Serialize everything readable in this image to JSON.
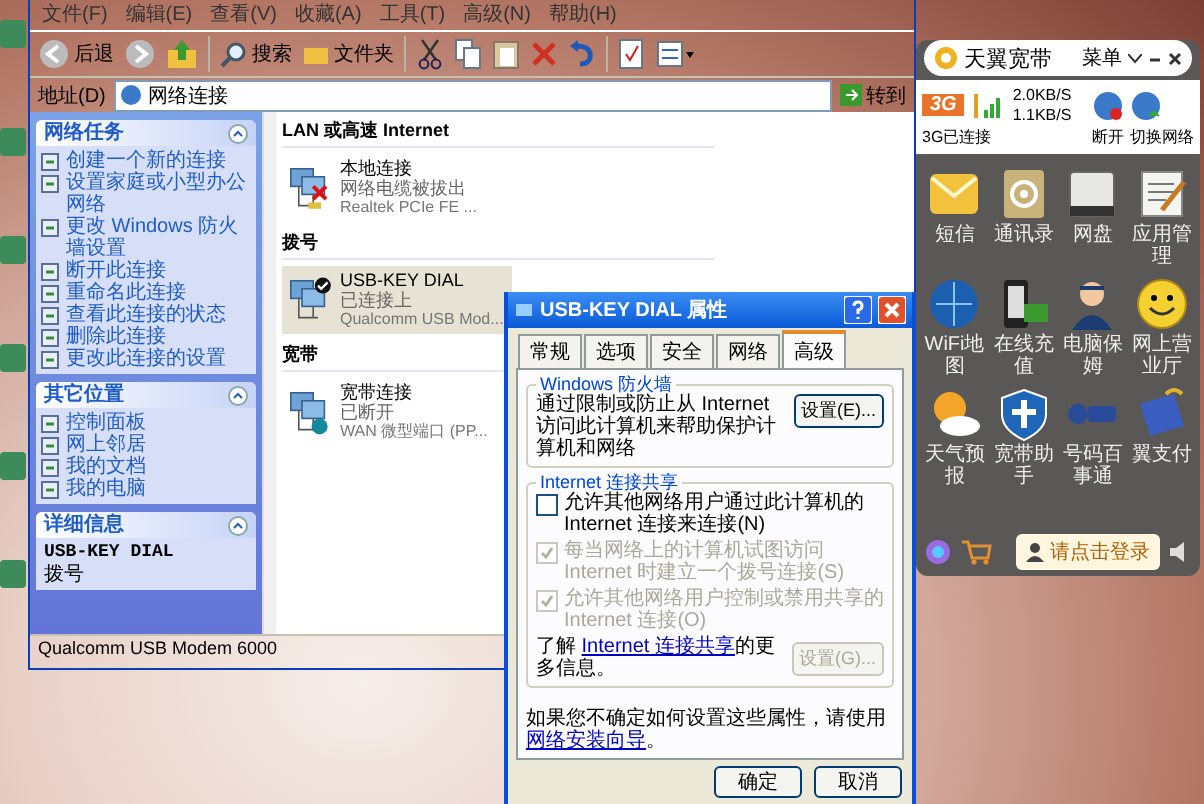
{
  "explorer": {
    "menu": [
      "文件(F)",
      "编辑(E)",
      "查看(V)",
      "收藏(A)",
      "工具(T)",
      "高级(N)",
      "帮助(H)"
    ],
    "toolbar": {
      "back": "后退",
      "search": "搜索",
      "folders": "文件夹"
    },
    "address": {
      "label": "地址(D)",
      "value": "网络连接",
      "go": "转到"
    },
    "sidebar": [
      {
        "title": "网络任务",
        "items": [
          "创建一个新的连接",
          "设置家庭或小型办公网络",
          "更改 Windows 防火墙设置",
          "断开此连接",
          "重命名此连接",
          "查看此连接的状态",
          "删除此连接",
          "更改此连接的设置"
        ]
      },
      {
        "title": "其它位置",
        "items": [
          "控制面板",
          "网上邻居",
          "我的文档",
          "我的电脑"
        ]
      }
    ],
    "details": {
      "title": "详细信息",
      "name": "USB-KEY DIAL",
      "type": "拨号"
    },
    "groups": [
      {
        "title": "LAN 或高速 Internet",
        "items": [
          {
            "name": "本地连接",
            "status": "网络电缆被拔出",
            "device": "Realtek PCIe FE ...",
            "kind": "unplugged",
            "selected": false
          }
        ]
      },
      {
        "title": "拨号",
        "items": [
          {
            "name": "USB-KEY DIAL",
            "status": "已连接上",
            "device": "Qualcomm USB Mod...",
            "kind": "connected",
            "selected": true
          }
        ]
      },
      {
        "title": "宽带",
        "items": [
          {
            "name": "宽带连接",
            "status": "已断开",
            "device": "WAN 微型端口 (PP...",
            "kind": "disconnected",
            "selected": false
          }
        ]
      }
    ],
    "status_bar": "Qualcomm USB Modem 6000"
  },
  "dialog": {
    "title": "USB-KEY DIAL 属性",
    "tabs": [
      {
        "label": "常规",
        "selected": false
      },
      {
        "label": "选项",
        "selected": false
      },
      {
        "label": "安全",
        "selected": false
      },
      {
        "label": "网络",
        "selected": false
      },
      {
        "label": "高级",
        "selected": true
      }
    ],
    "firewall": {
      "title": "Windows 防火墙",
      "text": "通过限制或防止从 Internet 访问此计算机来帮助保护计算机和网络",
      "button": "设置(E)..."
    },
    "sharing": {
      "title": "Internet 连接共享",
      "options": [
        {
          "label": "允许其他网络用户通过此计算机的 Internet 连接来连接(N)",
          "checked": false,
          "disabled": false
        },
        {
          "label": "每当网络上的计算机试图访问 Internet 时建立一个拨号连接(S)",
          "checked": true,
          "disabled": true
        },
        {
          "label": "允许其他网络用户控制或禁用共享的 Internet 连接(O)",
          "checked": true,
          "disabled": true
        }
      ],
      "learn": {
        "before": "了解 ",
        "link": "Internet 连接共享",
        "after": "的更多信息。"
      },
      "button": {
        "label": "设置(G)...",
        "disabled": true
      }
    },
    "footer": {
      "before": "如果您不确定如何设置这些属性，请使用",
      "link": "网络安装向导",
      "after": "。"
    },
    "buttons": [
      "确定",
      "取消"
    ]
  },
  "tray_app": {
    "title": "天翼宽带",
    "menu": "菜单",
    "badge": "3G",
    "status": "3G已连接",
    "upload": "2.0KB/S",
    "download": "1.1KB/S",
    "actions": [
      {
        "label": "断开",
        "kind": "disconnect"
      },
      {
        "label": "切换网络",
        "kind": "switch"
      }
    ],
    "apps": [
      {
        "label": "短信",
        "kind": "mail"
      },
      {
        "label": "通讯录",
        "kind": "contacts"
      },
      {
        "label": "网盘",
        "kind": "drive"
      },
      {
        "label": "应用管理",
        "kind": "notepad"
      },
      {
        "label": "WiFi地图",
        "kind": "globe"
      },
      {
        "label": "在线充值",
        "kind": "phone"
      },
      {
        "label": "电脑保姆",
        "kind": "person"
      },
      {
        "label": "网上营业厅",
        "kind": "smiley"
      },
      {
        "label": "天气预报",
        "kind": "weather"
      },
      {
        "label": "宽带助手",
        "kind": "shield"
      },
      {
        "label": "号码百事通",
        "kind": "logo"
      },
      {
        "label": "翼支付",
        "kind": "wallet"
      }
    ],
    "login": "请点击登录"
  }
}
